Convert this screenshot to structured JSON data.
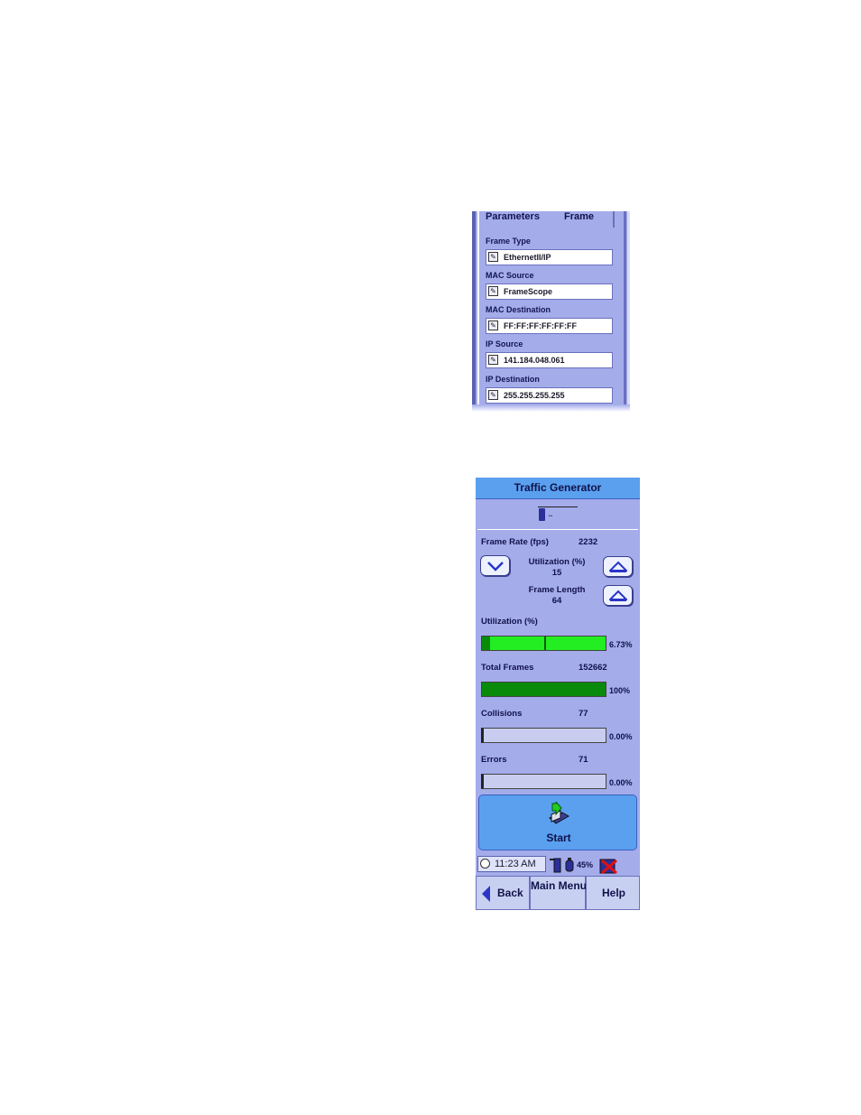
{
  "frame_panel": {
    "tabs": [
      "Parameters",
      "Frame"
    ],
    "fields": [
      {
        "label": "Frame Type",
        "value": "EthernetII/IP"
      },
      {
        "label": "MAC Source",
        "value": "FrameScope"
      },
      {
        "label": "MAC Destination",
        "value": "FF:FF:FF:FF:FF:FF"
      },
      {
        "label": "IP Source",
        "value": "141.184.048.061"
      },
      {
        "label": "IP Destination",
        "value": "255.255.255.255"
      }
    ]
  },
  "traffic_generator": {
    "title": "Traffic Generator",
    "logo_text": "..",
    "frame_rate": {
      "label": "Frame Rate (fps)",
      "value": "2232"
    },
    "utilization_setting": {
      "label": "Utilization (%)",
      "value": "15"
    },
    "frame_length": {
      "label": "Frame Length",
      "value": "64"
    },
    "meters": [
      {
        "label": "Utilization (%)",
        "count": "",
        "percent": "6.73%",
        "fill_fraction": 0.0673,
        "marker_fraction": 0.5
      },
      {
        "label": "Total Frames",
        "count": "152662",
        "percent": "100%",
        "fill_fraction": 1.0
      },
      {
        "label": "Collisions",
        "count": "77",
        "percent": "0.00%",
        "fill_fraction": 0
      },
      {
        "label": "Errors",
        "count": "71",
        "percent": "0.00%",
        "fill_fraction": 0
      }
    ],
    "start_label": "Start",
    "status": {
      "time": "11:23 AM",
      "battery": "45%"
    },
    "nav": {
      "back": "Back",
      "main_menu": "Main Menu",
      "help": "Help"
    }
  },
  "colors": {
    "panel_bg": "#a4acea",
    "title_bar": "#5aa0ef",
    "bar_green": "#22ee22",
    "bar_dark_green": "#0a8a0a"
  }
}
